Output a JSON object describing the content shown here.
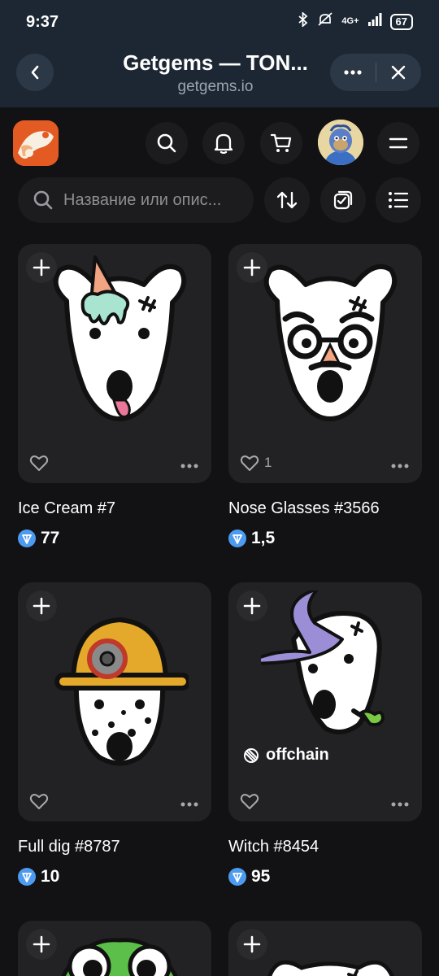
{
  "status_bar": {
    "time": "9:37",
    "network": "4G+",
    "battery": "67"
  },
  "browser": {
    "title": "Getgems — TON...",
    "url": "getgems.io"
  },
  "search": {
    "placeholder": "Название или опис..."
  },
  "items": [
    {
      "name": "Ice Cream #7",
      "price": "77",
      "likes": "",
      "offchain": ""
    },
    {
      "name": "Nose Glasses #3566",
      "price": "1,5",
      "likes": "1",
      "offchain": ""
    },
    {
      "name": "Full dig #8787",
      "price": "10",
      "likes": "",
      "offchain": ""
    },
    {
      "name": "Witch #8454",
      "price": "95",
      "likes": "",
      "offchain": "offchain"
    }
  ],
  "colors": {
    "accent": "#4d9bf0",
    "header_bg": "#1d2733",
    "page_bg": "#121214",
    "card_bg": "#222224",
    "logo": "#e35a22"
  }
}
